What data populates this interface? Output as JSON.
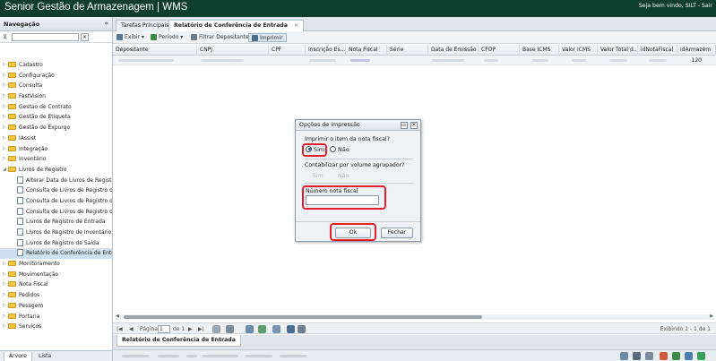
{
  "app": {
    "title": "Senior Gestão de Armazenagem | WMS",
    "welcome": "Seja bem vindo, SILT - Sair"
  },
  "sidebar": {
    "title": "Navegação",
    "collapse": "«",
    "filter_clear": "×",
    "items": [
      {
        "label": "Cadastro",
        "type": "folder"
      },
      {
        "label": "Configuração",
        "type": "folder"
      },
      {
        "label": "Consulta",
        "type": "folder"
      },
      {
        "label": "FastVision",
        "type": "folder"
      },
      {
        "label": "Gestao de Contrato",
        "type": "folder"
      },
      {
        "label": "Gestão de Etiqueta",
        "type": "folder"
      },
      {
        "label": "Gestão de Expurgo",
        "type": "folder"
      },
      {
        "label": "IAssist",
        "type": "folder"
      },
      {
        "label": "Integração",
        "type": "folder"
      },
      {
        "label": "Inventário",
        "type": "folder"
      },
      {
        "label": "Livros de Registro",
        "type": "folder-open"
      },
      {
        "label": "Alterar Data de Livros de Registro",
        "type": "doc"
      },
      {
        "label": "Consulta de Livros de Registro de",
        "type": "doc"
      },
      {
        "label": "Consulta de Livros de Registro de",
        "type": "doc"
      },
      {
        "label": "Consulta de Livros de Registro de",
        "type": "doc"
      },
      {
        "label": "Livros de Registro de Entrada",
        "type": "doc"
      },
      {
        "label": "Livros de Registro de Inventário",
        "type": "doc"
      },
      {
        "label": "Livros de Registro de Saída",
        "type": "doc"
      },
      {
        "label": "Relatório de Conferência de Entra",
        "type": "doc-selected"
      },
      {
        "label": "Monitoramento",
        "type": "folder"
      },
      {
        "label": "Movimentação",
        "type": "folder"
      },
      {
        "label": "Nota Fiscal",
        "type": "folder"
      },
      {
        "label": "Pedidos",
        "type": "folder"
      },
      {
        "label": "Pesagem",
        "type": "folder"
      },
      {
        "label": "Portaria",
        "type": "folder"
      },
      {
        "label": "Serviços",
        "type": "folder"
      }
    ],
    "tabs": [
      "Árvore",
      "Lista"
    ]
  },
  "tabs": [
    {
      "label": "Tarefas Principais",
      "active": false
    },
    {
      "label": "Relatório de Conferência de Entrada",
      "active": true
    }
  ],
  "tab_close": "×",
  "toolbar": {
    "exibir": "Exibir ▾",
    "periodo": "Período ▾",
    "filtrar": "Filtrar Depositante",
    "imprimir": "Imprimir"
  },
  "grid": {
    "columns": [
      "Depositante",
      "CNPJ",
      "CPF",
      "Inscrição Es...",
      "Nota Fiscal",
      "Série",
      "Data de Emissão",
      "CFOP",
      "Base ICMS",
      "Valor ICMS",
      "Valor Total d...",
      "idNotaFiscal",
      "idArmazém"
    ],
    "row": {
      "idArmazem": "120"
    }
  },
  "pager": {
    "page_label": "Página",
    "page_value": "1",
    "of_label": "de 1",
    "display": "Exibindo 1 - 1 de 1"
  },
  "bottom_tab": "Relatório de Conferência de Entrada",
  "dialog": {
    "title": "Opções de impressão",
    "minimize": "▭",
    "close": "×",
    "q1": "Imprimir o item da nota fiscal?",
    "yes": "Sim",
    "no": "Não",
    "q2": "Contabilizar por volume agrupador?",
    "yes2": "Sim",
    "no2": "Não",
    "field_label": "Número nota fiscal",
    "field_value": "",
    "ok": "Ok",
    "close_button": "Fechar"
  },
  "colors": {
    "topbar": "#0f3d2e",
    "highlight": "#e0202a",
    "selected_row": "#cfe0ee"
  }
}
